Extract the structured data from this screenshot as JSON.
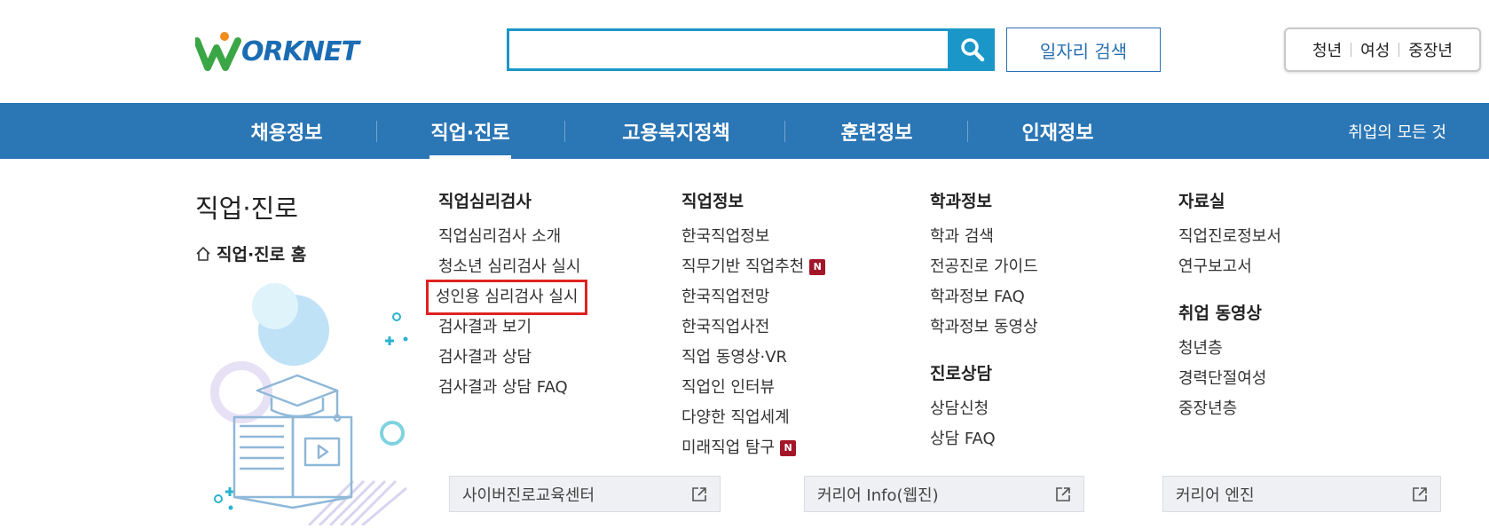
{
  "header": {
    "logo_text": "ORKNET",
    "search_placeholder": "",
    "job_search_label": "일자리 검색",
    "audience": [
      "청년",
      "여성",
      "중장년"
    ]
  },
  "nav": {
    "items": [
      "채용정보",
      "직업·진로",
      "고용복지정책",
      "훈련정보",
      "인재정보"
    ],
    "active_index": 1,
    "all_label": "취업의 모든 것"
  },
  "side": {
    "title": "직업·진로",
    "home_label": "직업·진로 홈"
  },
  "columns": {
    "psych": {
      "title": "직업심리검사",
      "links": [
        "직업심리검사 소개",
        "청소년 심리검사 실시",
        "성인용 심리검사 실시",
        "검사결과 보기",
        "검사결과 상담",
        "검사결과 상담 FAQ"
      ]
    },
    "jobinfo": {
      "title": "직업정보",
      "links": [
        "한국직업정보",
        "직무기반 직업추천",
        "한국직업전망",
        "한국직업사전",
        "직업 동영상·VR",
        "직업인 인터뷰",
        "다양한 직업세계",
        "미래직업 탐구"
      ],
      "new_badge": "N"
    },
    "major": {
      "title": "학과정보",
      "links": [
        "학과 검색",
        "전공진로 가이드",
        "학과정보 FAQ",
        "학과정보 동영상"
      ]
    },
    "counsel": {
      "title": "진로상담",
      "links": [
        "상담신청",
        "상담 FAQ"
      ]
    },
    "archive": {
      "title": "자료실",
      "links": [
        "직업진로정보서",
        "연구보고서"
      ]
    },
    "video": {
      "title": "취업 동영상",
      "links": [
        "청년층",
        "경력단절여성",
        "중장년층"
      ]
    }
  },
  "external_links": [
    "사이버진로교육센터",
    "커리어 Info(웹진)",
    "커리어 엔진"
  ],
  "colors": {
    "nav_bg": "#2b76b5",
    "search_accent": "#1a97c8",
    "highlight": "#e0221f",
    "badge_new": "#a3162a"
  }
}
